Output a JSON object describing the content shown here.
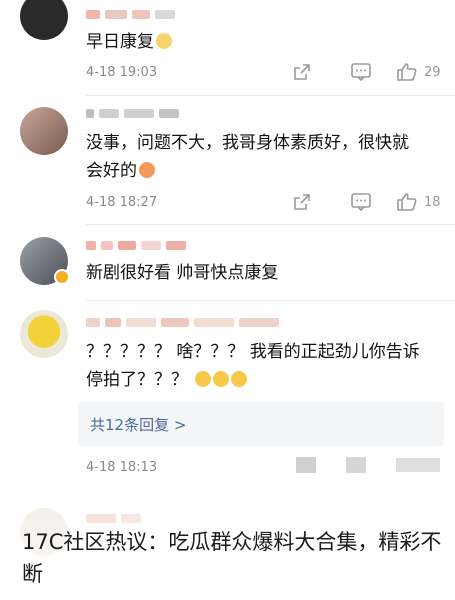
{
  "comments": [
    {
      "text": "早日康复",
      "time": "4-18 19:03",
      "likes": "29"
    },
    {
      "text_line1": "没事，问题不大，我哥身体素质好，很快就",
      "text_line2": "会好的",
      "time": "4-18 18:27",
      "likes": "18"
    },
    {
      "text": "新剧很好看 帅哥快点康复"
    },
    {
      "text_line1": "？？？？？ 啥？？？ 我看的正起劲儿你告诉",
      "text_line2": "停拍了？？？",
      "reply_link": "共12条回复 >",
      "time": "4-18 18:13"
    }
  ],
  "caption": "17C社区热议：吃瓜群众爆料大合集，精彩不断",
  "icons": {
    "share": "share-icon",
    "comment": "comment-icon",
    "like": "thumbs-up-icon"
  }
}
